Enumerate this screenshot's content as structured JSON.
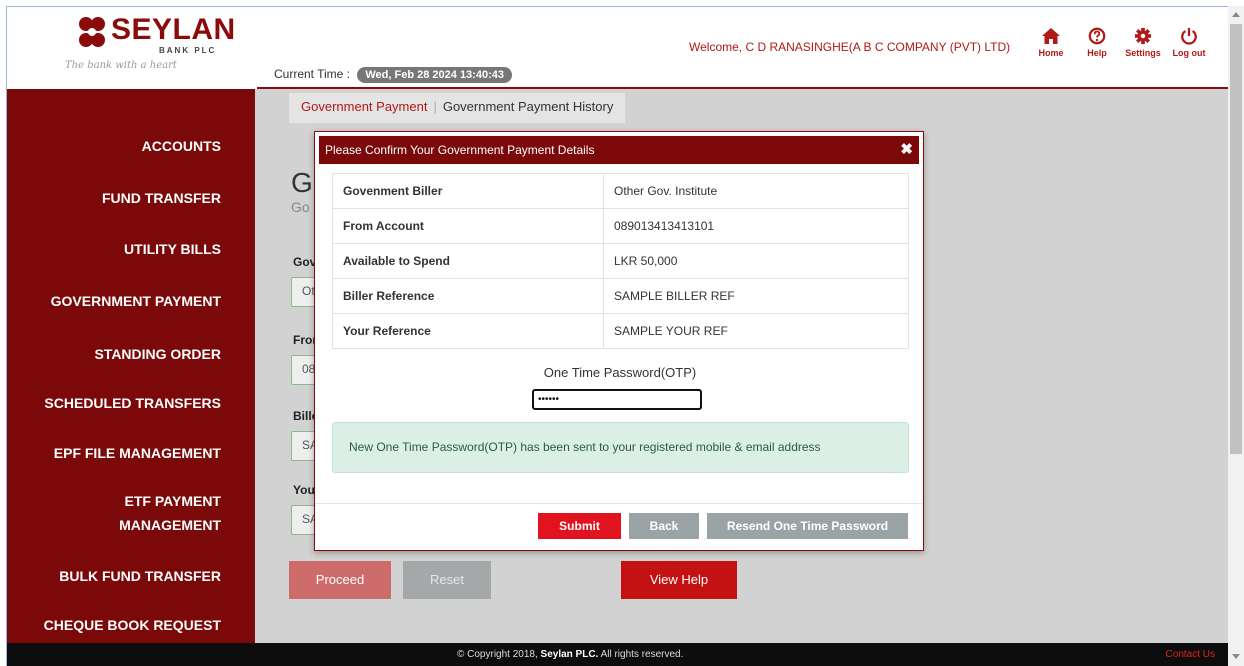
{
  "brand": {
    "name": "SEYLAN",
    "sub": "BANK PLC",
    "tagline": "The bank with a heart"
  },
  "header": {
    "current_time_label": "Current Time :",
    "current_time_value": "Wed, Feb 28 2024 13:40:43",
    "welcome": "Welcome, C D RANASINGHE(A B C COMPANY (PVT) LTD)",
    "nav": [
      {
        "label": "Home",
        "icon": "home-icon"
      },
      {
        "label": "Help",
        "icon": "help-icon"
      },
      {
        "label": "Settings",
        "icon": "gear-icon"
      },
      {
        "label": "Log out",
        "icon": "power-icon"
      }
    ]
  },
  "sidebar": {
    "items": [
      {
        "label": "ACCOUNTS"
      },
      {
        "label": "FUND TRANSFER"
      },
      {
        "label": "UTILITY BILLS"
      },
      {
        "label": "GOVERNMENT PAYMENT"
      },
      {
        "label": "STANDING ORDER"
      },
      {
        "label": "SCHEDULED TRANSFERS"
      },
      {
        "label": "EPF FILE MANAGEMENT"
      },
      {
        "label": "ETF PAYMENT",
        "label2": "MANAGEMENT"
      },
      {
        "label": "BULK FUND TRANSFER"
      },
      {
        "label": "CHEQUE BOOK REQUEST"
      }
    ]
  },
  "subnav": {
    "active": "Government Payment",
    "other": "Government Payment History",
    "separator": "|"
  },
  "background_form": {
    "heading": "G",
    "subheading": "Go",
    "labels": [
      "Gov",
      "Fron",
      "Bille",
      "You"
    ],
    "values": [
      "Ot",
      "08",
      "SA",
      "SA"
    ],
    "proceed_label": "Proceed",
    "reset_label": "Reset",
    "view_help_label": "View Help"
  },
  "modal": {
    "title": "Please Confirm Your Government Payment Details",
    "close_glyph": "✖",
    "rows": [
      {
        "key": "Govenment Biller",
        "value": "Other Gov. Institute"
      },
      {
        "key": "From Account",
        "value": "089013413413101"
      },
      {
        "key": "Available to Spend",
        "value": "LKR 50,000"
      },
      {
        "key": "Biller Reference",
        "value": "SAMPLE BILLER REF"
      },
      {
        "key": "Your Reference",
        "value": "SAMPLE YOUR REF"
      }
    ],
    "otp_label": "One Time Password(OTP)",
    "otp_value": "••••••",
    "notice": "New One Time Password(OTP) has been sent to your registered mobile & email address",
    "submit_label": "Submit",
    "back_label": "Back",
    "resend_label": "Resend One Time Password"
  },
  "footer": {
    "copyright_prefix": "© Copyright 2018,",
    "company": "Seylan PLC.",
    "copyright_suffix": "All rights reserved.",
    "contact": "Contact Us"
  },
  "colors": {
    "brand_red": "#7b0909",
    "accent_red": "#b11818",
    "submit_red": "#e0131f",
    "muted_button": "#9aa3a6",
    "notice_bg": "#dcefe6"
  }
}
